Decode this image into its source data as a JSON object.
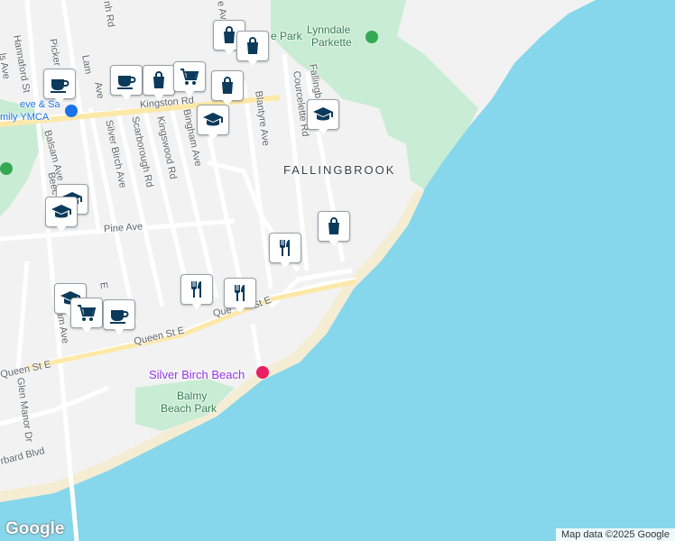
{
  "map": {
    "colors": {
      "water": "#87d7ec",
      "land": "#f2f2f2",
      "park": "#c9ecd4",
      "beach": "#f5edd3",
      "road": "#ffffff",
      "major_road": "#fde9a7",
      "marker_icon": "#0b3a5b",
      "poi_label": "#9334e6"
    },
    "area_labels": {
      "neighborhood": "FALLINGBROOK"
    },
    "parks": {
      "lynndale_1": "Lynndale",
      "lynndale_2": "Parkette",
      "park_fragment": "e Park",
      "balmy_1": "Balmy",
      "balmy_2": "Beach Park"
    },
    "poi": {
      "ymca_1": "eve & Sa",
      "ymca_2": "mily YMCA",
      "beach": "Silver Birch Beach"
    },
    "streets": {
      "kingston": "Kingston Rd",
      "queen_1": "Queen St E",
      "queen_2": "Queen St E",
      "queen_3": "Que",
      "queen_4": "St E",
      "pine": "Pine Ave",
      "balsam": "Balsam Ave",
      "silver_birch": "Silver Birch Ave",
      "scarborough": "Scarborough Rd",
      "kingswood": "Kingswood Rd",
      "bingham": "Bingham Ave",
      "blantyre": "Blantyre Ave",
      "courcelette": "Courcelette Rd",
      "fallingbrook": "Fallingb",
      "hannaford": "Hannaford St",
      "pickering": "Picker",
      "glen_manor": "Glen Manor Dr",
      "beech": "Beec",
      "nh_rd": "nh Rd",
      "ave_top": "e Ave",
      "lam": "Lam",
      "ls_ave": "ls Ave",
      "ve": "Ave",
      "rbard": "rbard Blvd",
      "balsam_lower": "am Ave",
      "e_ave": "E"
    },
    "markers": [
      {
        "icon": "shopping-bag"
      },
      {
        "icon": "shopping-bag"
      },
      {
        "icon": "coffee"
      },
      {
        "icon": "coffee"
      },
      {
        "icon": "shopping-bag"
      },
      {
        "icon": "shopping-cart"
      },
      {
        "icon": "shopping-bag"
      },
      {
        "icon": "school"
      },
      {
        "icon": "school"
      },
      {
        "icon": "school"
      },
      {
        "icon": "school"
      },
      {
        "icon": "shopping-bag"
      },
      {
        "icon": "restaurant"
      },
      {
        "icon": "school"
      },
      {
        "icon": "shopping-cart"
      },
      {
        "icon": "coffee"
      },
      {
        "icon": "restaurant"
      },
      {
        "icon": "restaurant"
      }
    ],
    "attribution": "Map data ©2025 Google",
    "logo": "Google"
  }
}
